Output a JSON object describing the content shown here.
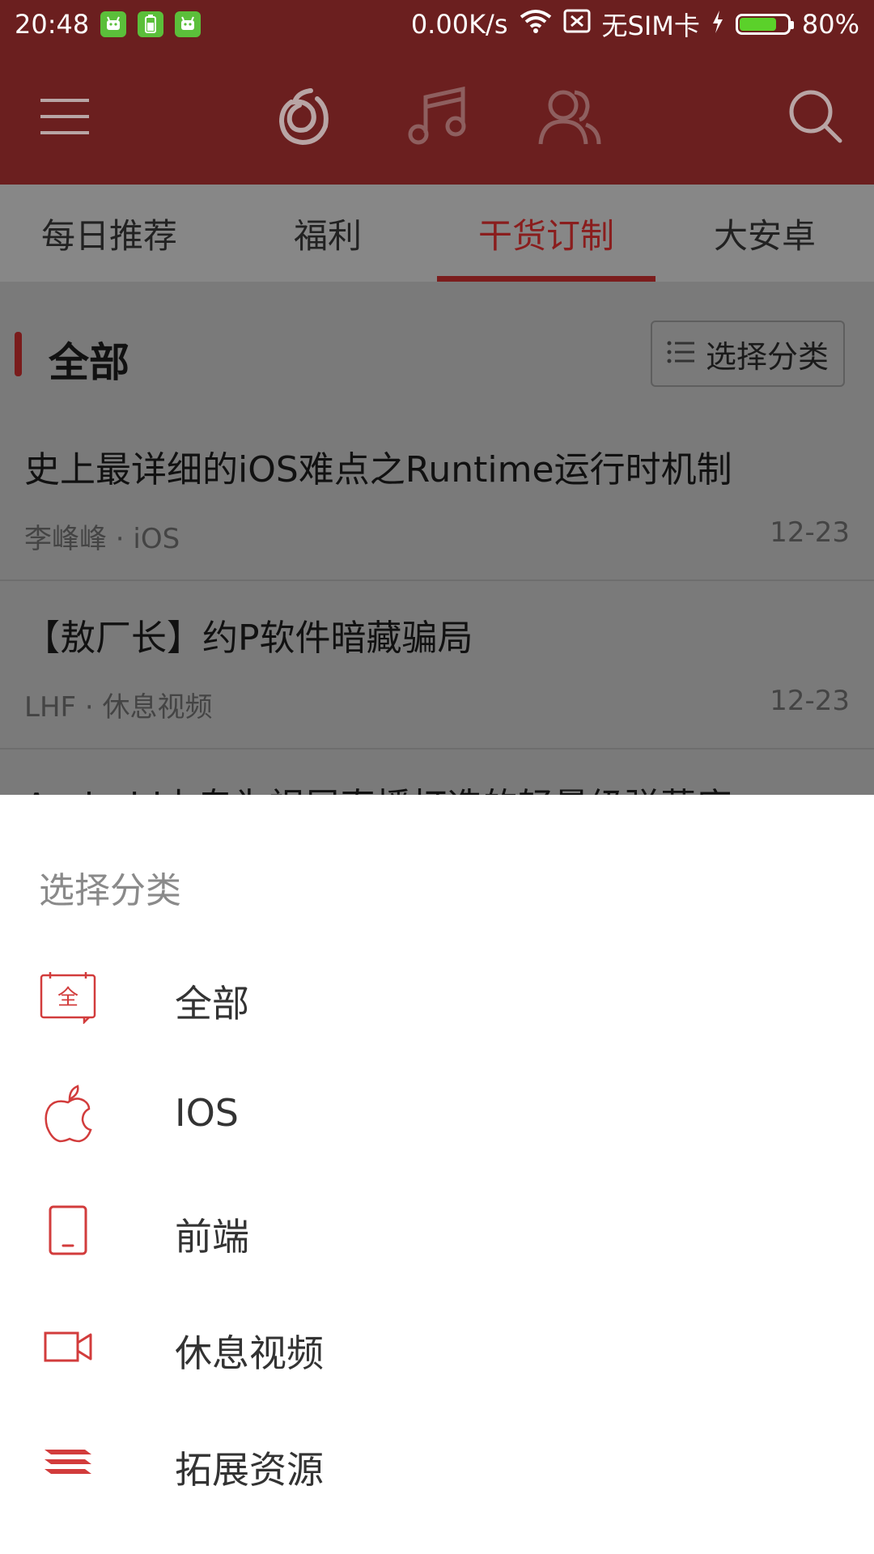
{
  "status": {
    "time": "20:48",
    "net_speed": "0.00K/s",
    "sim": "无SIM卡",
    "battery_pct": "80%",
    "battery_level": 0.8
  },
  "appbar": {
    "icons": [
      "menu-icon",
      "netease-music-icon",
      "music-note-icon",
      "friends-icon",
      "search-icon"
    ],
    "accent_color": "#6b1f1f"
  },
  "tabs": [
    {
      "label": "每日推荐"
    },
    {
      "label": "福利"
    },
    {
      "label": "干货订制"
    },
    {
      "label": "大安卓"
    }
  ],
  "section": {
    "title": "全部",
    "filter_label": "选择分类"
  },
  "articles": [
    {
      "title": "史上最详细的iOS难点之Runtime运行时机制",
      "meta": "李峰峰 · iOS",
      "date": "12-23"
    },
    {
      "title": "【敖厂长】约P软件暗藏骗局",
      "meta": "LHF · 休息视频",
      "date": "12-23"
    },
    {
      "title": "Android上专为视屏直播打造的轻量级弹幕库",
      "meta": "",
      "date": ""
    }
  ],
  "sheet": {
    "title": "选择分类",
    "items": [
      {
        "label": "全部",
        "icon": "calendar-all-icon"
      },
      {
        "label": "IOS",
        "icon": "apple-icon"
      },
      {
        "label": "前端",
        "icon": "tablet-icon"
      },
      {
        "label": "休息视频",
        "icon": "video-camera-icon"
      },
      {
        "label": "拓展资源",
        "icon": "layers-icon"
      }
    ]
  }
}
